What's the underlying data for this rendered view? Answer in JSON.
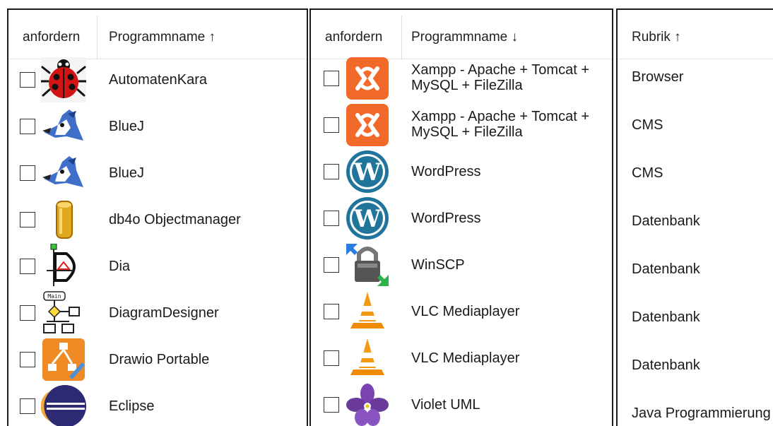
{
  "left_table": {
    "col_request": "anfordern",
    "col_name": "Programmname ↑",
    "rows": [
      {
        "name": "AutomatenKara",
        "icon": "ladybug-icon"
      },
      {
        "name": "BlueJ",
        "icon": "bluejay-bird-icon"
      },
      {
        "name": "BlueJ",
        "icon": "bluejay-bird-icon"
      },
      {
        "name": "db4o Objectmanager",
        "icon": "gold-cylinder-icon"
      },
      {
        "name": "Dia",
        "icon": "dia-diagram-icon"
      },
      {
        "name": "DiagramDesigner",
        "icon": "flowchart-icon"
      },
      {
        "name": "Drawio Portable",
        "icon": "drawio-icon"
      },
      {
        "name": "Eclipse",
        "icon": "eclipse-icon"
      }
    ]
  },
  "middle_table": {
    "col_request": "anfordern",
    "col_name": "Programmname ↓",
    "rows": [
      {
        "name": "Xampp - Apache + Tomcat + MySQL + FileZilla",
        "icon": "xampp-icon"
      },
      {
        "name": "Xampp - Apache + Tomcat + MySQL + FileZilla",
        "icon": "xampp-icon"
      },
      {
        "name": "WordPress",
        "icon": "wordpress-icon"
      },
      {
        "name": "WordPress",
        "icon": "wordpress-icon"
      },
      {
        "name": "WinSCP",
        "icon": "winscp-padlock-icon"
      },
      {
        "name": "VLC Mediaplayer",
        "icon": "vlc-cone-icon"
      },
      {
        "name": "VLC Mediaplayer",
        "icon": "vlc-cone-icon"
      },
      {
        "name": "Violet UML",
        "icon": "violet-flower-icon"
      }
    ]
  },
  "right_table": {
    "col_category": "Rubrik ↑",
    "rows": [
      "Browser",
      "CMS",
      "CMS",
      "Datenbank",
      "Datenbank",
      "Datenbank",
      "Datenbank",
      "Java Programmierung"
    ]
  },
  "colors": {
    "panel_border": "#1c1c1c",
    "xampp_orange": "#f26a2a",
    "wordpress_blue": "#21759b",
    "vlc_orange": "#f08a00",
    "violet_purple": "#6a3a9a"
  }
}
